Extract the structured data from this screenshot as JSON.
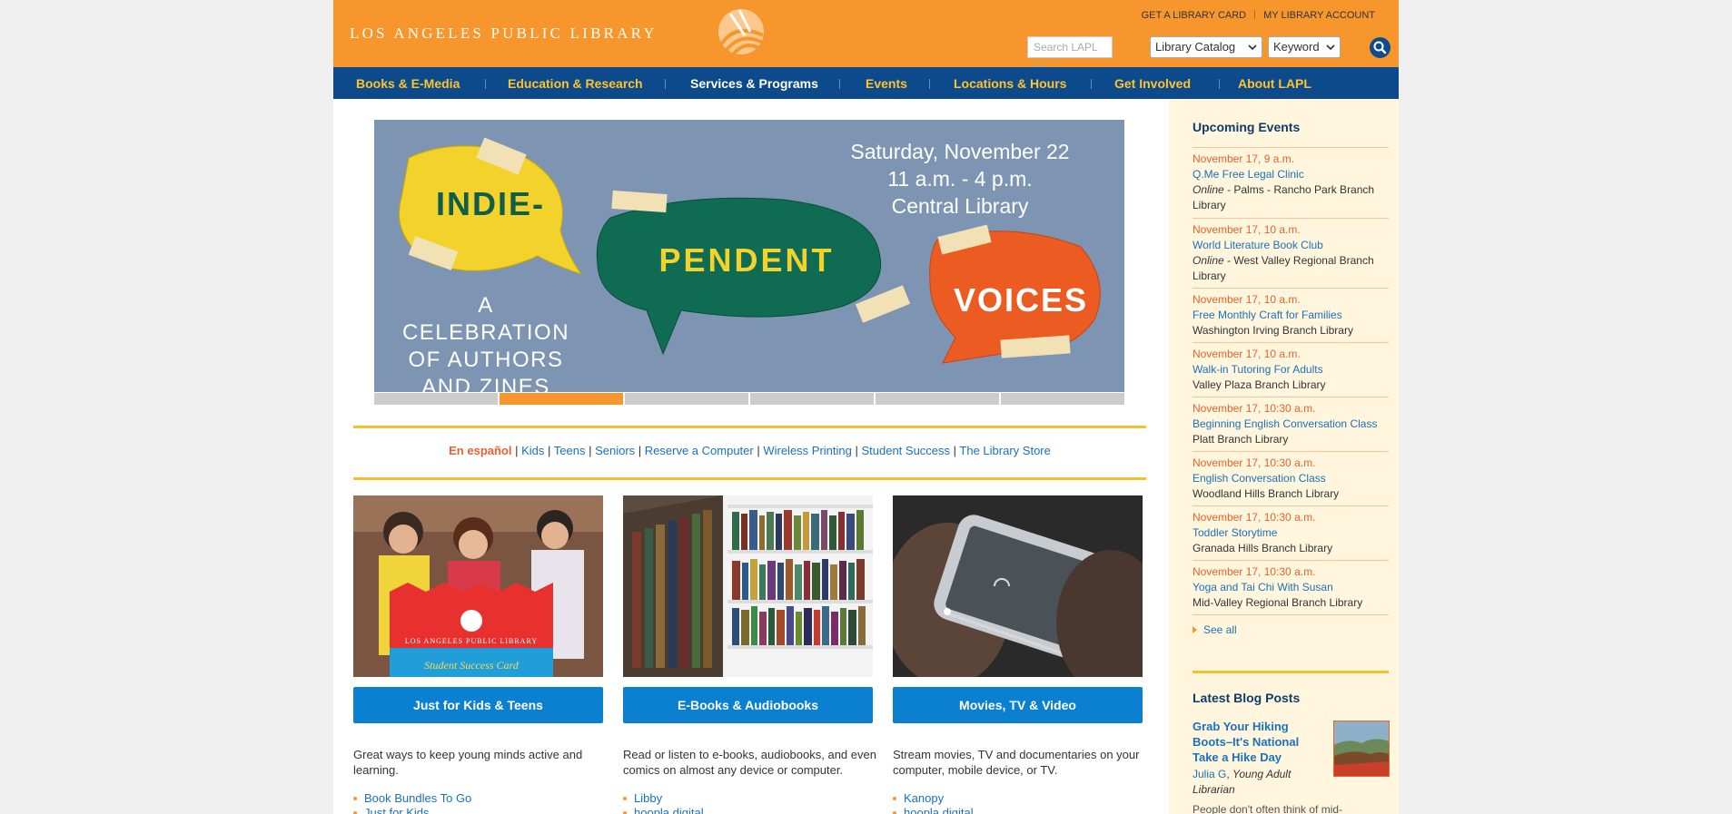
{
  "header": {
    "logo_text": "LOS ANGELES PUBLIC LIBRARY",
    "util_links": [
      "GET A LIBRARY CARD",
      "MY LIBRARY ACCOUNT"
    ],
    "search_placeholder": "Search LAPL for:",
    "catalog_select": "Library Catalog",
    "mode_select": "Keyword",
    "search_icon": "search-icon",
    "brand_color": "#f7962c"
  },
  "nav": {
    "items": [
      {
        "label": "Books & E-Media"
      },
      {
        "label": "Education & Research"
      },
      {
        "label": "Services & Programs"
      },
      {
        "label": "Events"
      },
      {
        "label": "Locations & Hours"
      },
      {
        "label": "Get Involved"
      },
      {
        "label": "About LAPL"
      }
    ],
    "active": "Services & Programs",
    "color": "#0d4a8b"
  },
  "hero": {
    "date": "Saturday, November 22",
    "time": "11 a.m. - 4 p.m.",
    "location": "Central Library",
    "bubble1": "INDIE-",
    "bubble2": "PENDENT",
    "bubble3": "VOICES",
    "tagline": [
      "A CELEBRATION",
      "OF AUTHORS",
      "AND ZINES"
    ],
    "slide_count": 6,
    "active_slide": 2
  },
  "quick_links": {
    "spanish": "En español",
    "items": [
      "Kids",
      "Teens",
      "Seniors",
      "Reserve a Computer",
      "Wireless Printing",
      "Student Success",
      "The Library Store"
    ]
  },
  "cards": [
    {
      "button": "Just for Kids & Teens",
      "desc": "Great ways to keep young minds active and learning.",
      "links": [
        "Book Bundles To Go",
        "Just for Kids"
      ],
      "card_logo": "LOS ANGELES PUBLIC LIBRARY",
      "card_script": "Student Success Card"
    },
    {
      "button": "E-Books & Audiobooks",
      "desc": "Read or listen to e-books, audiobooks, and even comics on almost any device or computer.",
      "links": [
        "Libby",
        "hoopla digital"
      ]
    },
    {
      "button": "Movies, TV & Video",
      "desc": "Stream movies, TV and documentaries on your computer, mobile device, or TV.",
      "links": [
        "Kanopy",
        "hoopla digital"
      ]
    }
  ],
  "events": {
    "title": "Upcoming Events",
    "items": [
      {
        "date": "November 17, 9 a.m.",
        "title": "Q.Me Free Legal Clinic",
        "prefix": "Online",
        "loc": " - Palms - Rancho Park Branch Library"
      },
      {
        "date": "November 17, 10 a.m.",
        "title": "World Literature Book Club",
        "prefix": "Online",
        "loc": " - West Valley Regional Branch Library"
      },
      {
        "date": "November 17, 10 a.m.",
        "title": "Free Monthly Craft for Families",
        "prefix": "",
        "loc": "Washington Irving Branch Library"
      },
      {
        "date": "November 17, 10 a.m.",
        "title": "Walk-in Tutoring For Adults",
        "prefix": "",
        "loc": "Valley Plaza Branch Library"
      },
      {
        "date": "November 17, 10:30 a.m.",
        "title": "Beginning English Conversation Class",
        "prefix": "",
        "loc": "Platt Branch Library"
      },
      {
        "date": "November 17, 10:30 a.m.",
        "title": "English Conversation Class",
        "prefix": "",
        "loc": "Woodland Hills Branch Library"
      },
      {
        "date": "November 17, 10:30 a.m.",
        "title": "Toddler Storytime",
        "prefix": "",
        "loc": "Granada Hills Branch Library"
      },
      {
        "date": "November 17, 10:30 a.m.",
        "title": "Yoga and Tai Chi With Susan",
        "prefix": "",
        "loc": "Mid-Valley Regional Branch Library"
      }
    ],
    "see_all": "See all"
  },
  "blog": {
    "title": "Latest Blog Posts",
    "post_title": "Grab Your Hiking Boots–It's National Take a Hike Day",
    "author": "Julia G",
    "author_role": "Young Adult Librarian",
    "teaser": "People don't often think of mid-"
  }
}
